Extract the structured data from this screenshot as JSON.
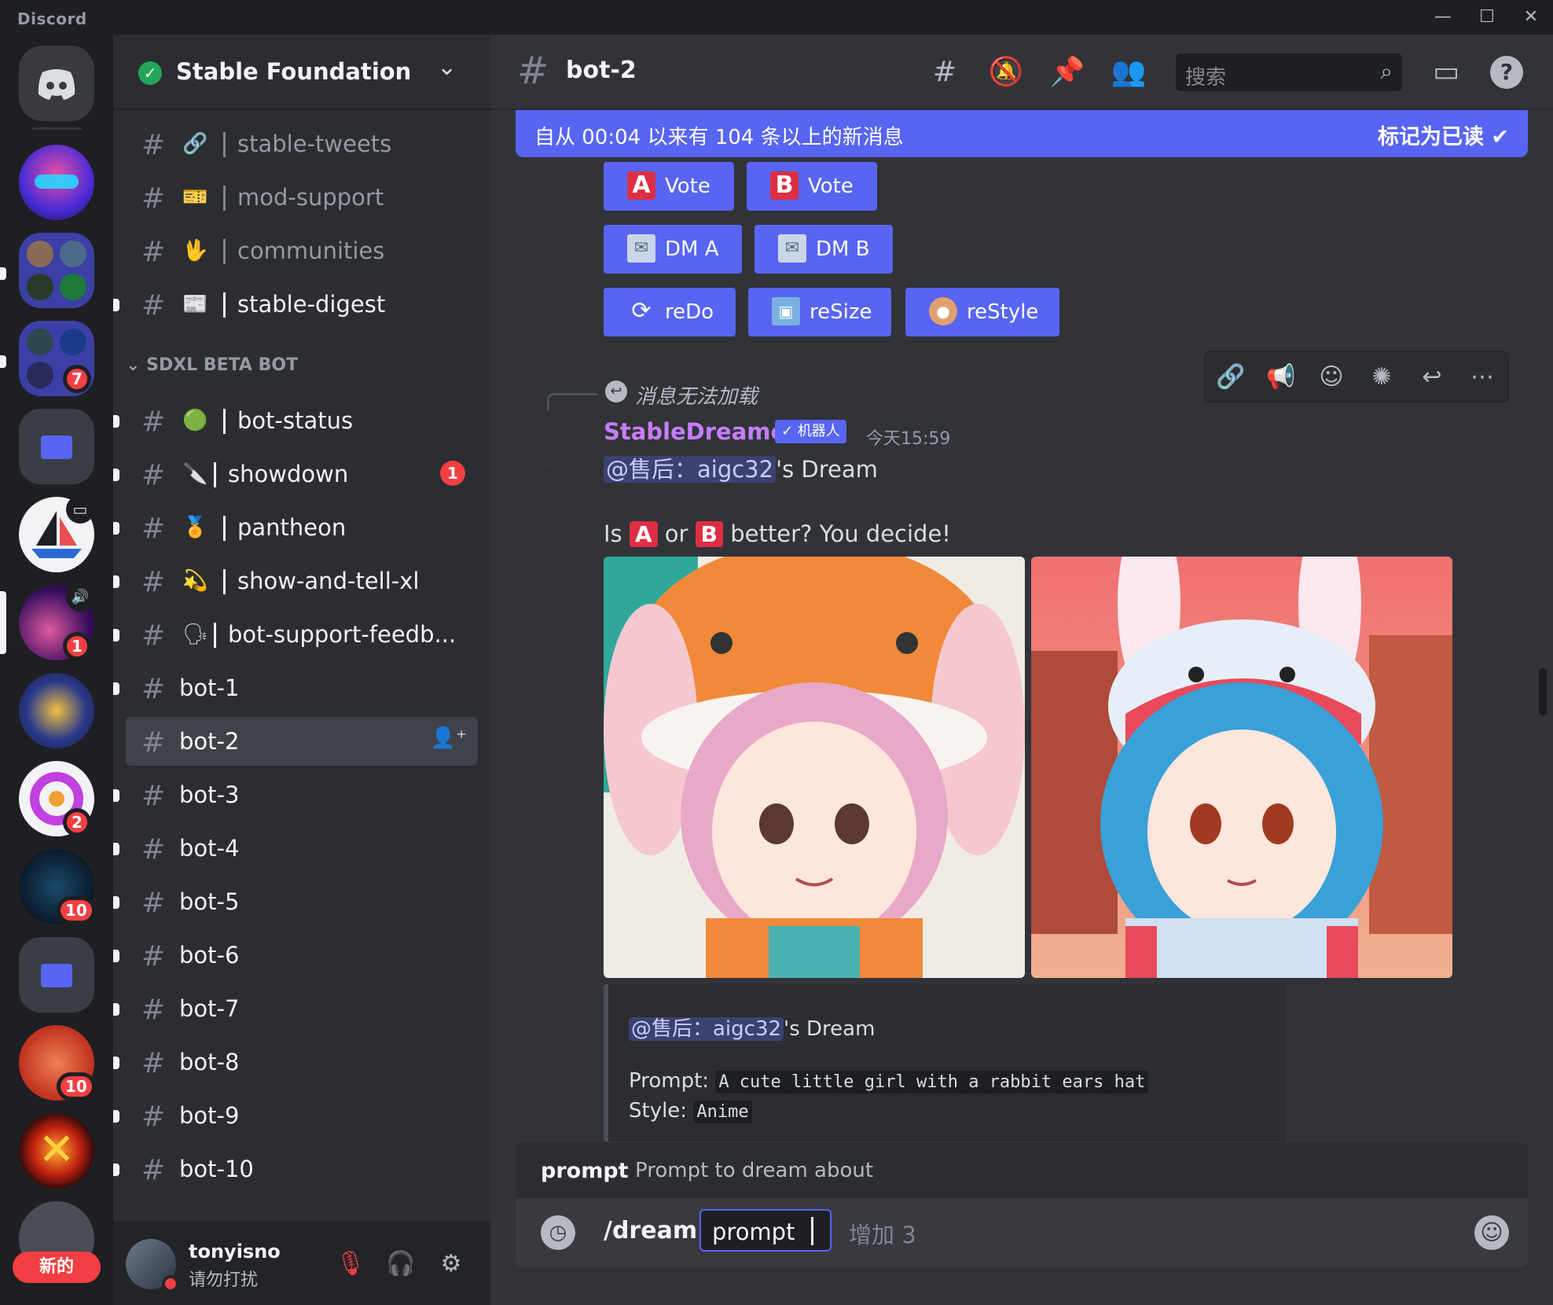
{
  "app": {
    "title": "Discord"
  },
  "servers": [
    {
      "badge": ""
    },
    {
      "badge": ""
    },
    {
      "badge": "7"
    },
    {
      "badge": ""
    },
    {
      "badge": ""
    },
    {
      "badge": "1"
    },
    {
      "badge": ""
    },
    {
      "badge": "2"
    },
    {
      "badge": "10"
    },
    {
      "badge": ""
    },
    {
      "badge": "10"
    },
    {
      "badge": ""
    }
  ],
  "rail": {
    "new_label": "新的"
  },
  "guild": {
    "name": "Stable Foundation"
  },
  "channels": [
    {
      "emoji": "🔗",
      "name": "stable-tweets"
    },
    {
      "emoji": "🎫",
      "name": "mod-support"
    },
    {
      "emoji": "🖖",
      "name": "communities"
    },
    {
      "emoji": "📰",
      "name": "stable-digest"
    },
    {
      "emoji": "🟢",
      "name": "bot-status"
    },
    {
      "emoji": "🔪",
      "name": "showdown",
      "mentions": "1"
    },
    {
      "emoji": "🏅",
      "name": "pantheon"
    },
    {
      "emoji": "💫",
      "name": "show-and-tell-xl"
    },
    {
      "emoji": "🗣",
      "name": "bot-support-feedb..."
    },
    {
      "name": "bot-1"
    },
    {
      "name": "bot-2"
    },
    {
      "name": "bot-3"
    },
    {
      "name": "bot-4"
    },
    {
      "name": "bot-5"
    },
    {
      "name": "bot-6"
    },
    {
      "name": "bot-7"
    },
    {
      "name": "bot-8"
    },
    {
      "name": "bot-9"
    },
    {
      "name": "bot-10"
    }
  ],
  "category": {
    "name": "SDXL BETA BOT"
  },
  "user": {
    "name": "tonyisno",
    "status": "请勿打扰"
  },
  "channel": {
    "title": "bot-2"
  },
  "search": {
    "placeholder": "搜索"
  },
  "new_messages": {
    "text": "自从 00:04 以来有 104 条以上的新消息",
    "mark_read": "标记为已读"
  },
  "buttons": {
    "vote_a": {
      "badge": "A",
      "label": "Vote"
    },
    "vote_b": {
      "badge": "B",
      "label": "Vote"
    },
    "dm_a": "DM A",
    "dm_b": "DM B",
    "redo": "reDo",
    "resize": "reSize",
    "restyle": "reStyle"
  },
  "message": {
    "reply_unavailable": "消息无法加载",
    "author": "StableDreamer",
    "bot_tag": "✓ 机器人",
    "timestamp": "今天15:59",
    "mention": "@售后：aigc32",
    "dream_suffix": "'s Dream",
    "q_is": "Is",
    "q_a": "A",
    "q_or": "or",
    "q_b": "B",
    "q_rest": "better? You decide!"
  },
  "embed": {
    "mention": "@售后：aigc32",
    "dream_suffix": "'s Dream",
    "prompt_label": "Prompt:",
    "prompt_value": "A cute little girl with a rabbit ears hat",
    "style_label": "Style:",
    "style_value": "Anime"
  },
  "composer": {
    "option_name": "prompt",
    "option_desc": "Prompt to dream about",
    "command": "/dream",
    "option_value": "prompt",
    "more_options": "增加 3"
  },
  "colors": {
    "blurple": "#5865f2",
    "danger": "#f23f43",
    "bot_name": "#c77dff"
  }
}
